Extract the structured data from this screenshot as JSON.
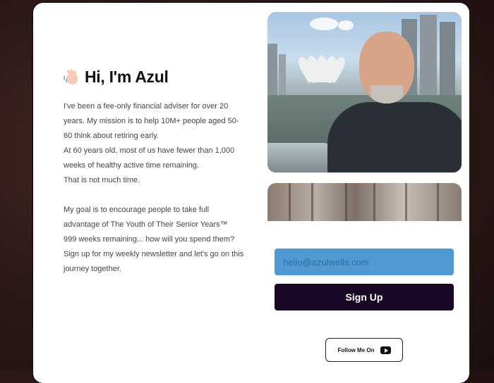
{
  "intro": {
    "title": "Hi, I'm Azul",
    "bio": [
      "I've been a fee-only financial adviser for over 20 years. My mission is to help 10M+ people aged 50-60 think about retiring early.",
      "At 60 years old, most of us have fewer than 1,000 weeks of healthy active time remaining.",
      "That is not much time.",
      "My goal is to encourage people to take full advantage of The Youth of Their Senior Years™",
      "999 weeks remaining... how will you spend them?",
      "Sign up for my weekly newsletter and let's go on this journey together."
    ]
  },
  "signup": {
    "email_placeholder": "hello@azulwells.com",
    "button_label": "Sign Up"
  },
  "follow": {
    "label": "Follow Me On",
    "icon": "youtube-icon"
  },
  "colors": {
    "input_bg": "#4f9ad2",
    "button_bg": "#1a0625"
  }
}
